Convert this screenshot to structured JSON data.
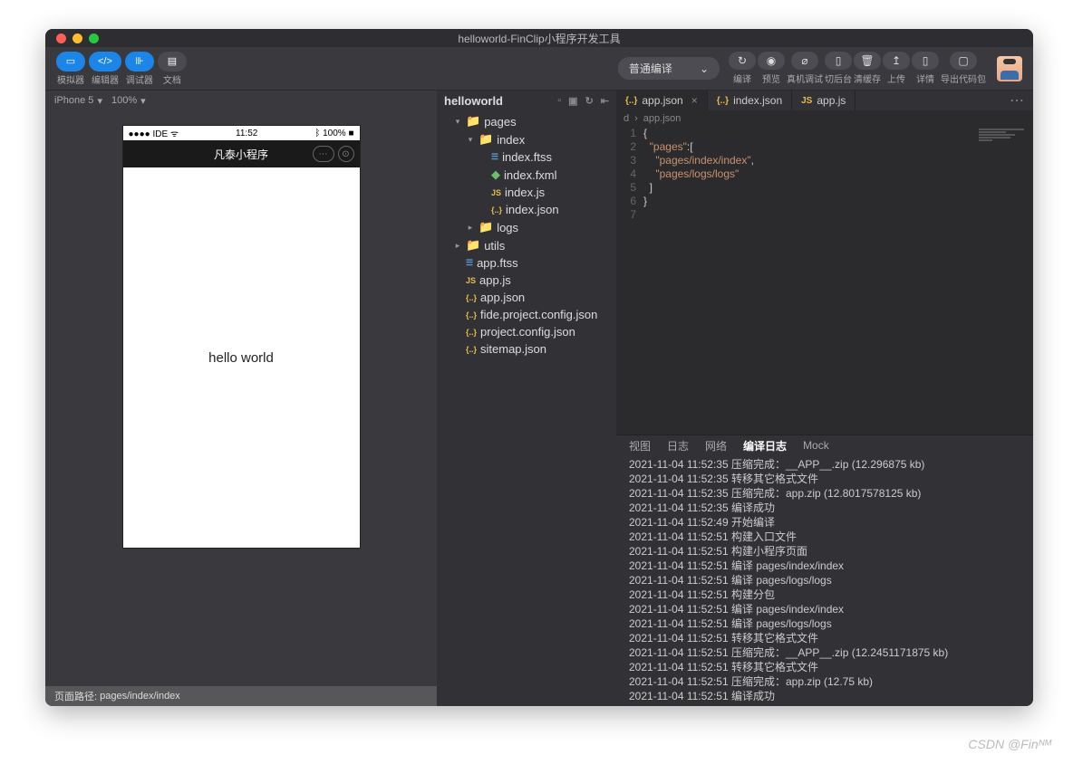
{
  "title": "helloworld-FinClip小程序开发工具",
  "toolbar": {
    "left": [
      "模拟器",
      "编辑器",
      "调试器",
      "文档"
    ],
    "dropdown": "普通编译",
    "actions": [
      {
        "icon": "↻",
        "label": "编译"
      },
      {
        "icon": "◉",
        "label": "预览"
      },
      {
        "icon": "⌀",
        "label": "真机调试"
      },
      {
        "icon": "▯",
        "label": "切后台"
      },
      {
        "icon": "🗑",
        "label": "清缓存"
      },
      {
        "icon": "↥",
        "label": "上传"
      },
      {
        "icon": "▯",
        "label": "详情"
      },
      {
        "icon": "▢",
        "label": "导出代码包"
      }
    ]
  },
  "simulator": {
    "device": "iPhone 5",
    "zoom": "100%",
    "statusbar": {
      "carrier": "IDE",
      "wifi": "ᯤ",
      "time": "11:52",
      "bt": "100%",
      "batt": "■"
    },
    "appbar_title": "凡泰小程序",
    "content": "hello world",
    "footer_label": "页面路径:",
    "footer_path": "pages/index/index"
  },
  "explorer": {
    "root": "helloworld",
    "tree": [
      {
        "type": "folder",
        "name": "pages",
        "depth": 0,
        "open": true
      },
      {
        "type": "folder",
        "name": "index",
        "depth": 1,
        "open": true
      },
      {
        "type": "file",
        "name": "index.ftss",
        "icon": "ftss",
        "depth": 2
      },
      {
        "type": "file",
        "name": "index.fxml",
        "icon": "fxml",
        "depth": 2
      },
      {
        "type": "file",
        "name": "index.js",
        "icon": "js",
        "depth": 2
      },
      {
        "type": "file",
        "name": "index.json",
        "icon": "json",
        "depth": 2
      },
      {
        "type": "folder",
        "name": "logs",
        "depth": 1,
        "open": false
      },
      {
        "type": "folder",
        "name": "utils",
        "depth": 0,
        "open": false
      },
      {
        "type": "file",
        "name": "app.ftss",
        "icon": "ftss",
        "depth": 0
      },
      {
        "type": "file",
        "name": "app.js",
        "icon": "js",
        "depth": 0
      },
      {
        "type": "file",
        "name": "app.json",
        "icon": "json",
        "depth": 0
      },
      {
        "type": "file",
        "name": "fide.project.config.json",
        "icon": "json",
        "depth": 0
      },
      {
        "type": "file",
        "name": "project.config.json",
        "icon": "json",
        "depth": 0
      },
      {
        "type": "file",
        "name": "sitemap.json",
        "icon": "json",
        "depth": 0
      }
    ]
  },
  "editor": {
    "tabs": [
      {
        "name": "app.json",
        "icon": "{..}",
        "active": true,
        "close": true
      },
      {
        "name": "index.json",
        "icon": "{..}",
        "active": false
      },
      {
        "name": "app.js",
        "icon": "JS",
        "active": false
      }
    ],
    "breadcrumb": [
      "d",
      "app.json"
    ],
    "code": [
      "{",
      "  \"pages\":[",
      "    \"pages/index/index\",",
      "    \"pages/logs/logs\"",
      "  ]",
      "}",
      ""
    ]
  },
  "console": {
    "tabs": [
      "视图",
      "日志",
      "网络",
      "编译日志",
      "Mock"
    ],
    "active_tab": "编译日志",
    "lines": [
      "2021-11-04 11:52:35 压缩完成：__APP__.zip (12.296875 kb)",
      "2021-11-04 11:52:35 转移其它格式文件",
      "2021-11-04 11:52:35 压缩完成：app.zip (12.8017578125 kb)",
      "2021-11-04 11:52:35 编译成功",
      "2021-11-04 11:52:49 开始编译",
      "2021-11-04 11:52:51 构建入口文件",
      "2021-11-04 11:52:51 构建小程序页面",
      "2021-11-04 11:52:51 编译 pages/index/index",
      "2021-11-04 11:52:51 编译 pages/logs/logs",
      "2021-11-04 11:52:51 构建分包",
      "2021-11-04 11:52:51 编译 pages/index/index",
      "2021-11-04 11:52:51 编译 pages/logs/logs",
      "2021-11-04 11:52:51 转移其它格式文件",
      "2021-11-04 11:52:51 压缩完成：__APP__.zip (12.2451171875 kb)",
      "2021-11-04 11:52:51 转移其它格式文件",
      "2021-11-04 11:52:51 压缩完成：app.zip (12.75 kb)",
      "2021-11-04 11:52:51 编译成功"
    ]
  },
  "watermark": "CSDN @Finᴺᴹ"
}
